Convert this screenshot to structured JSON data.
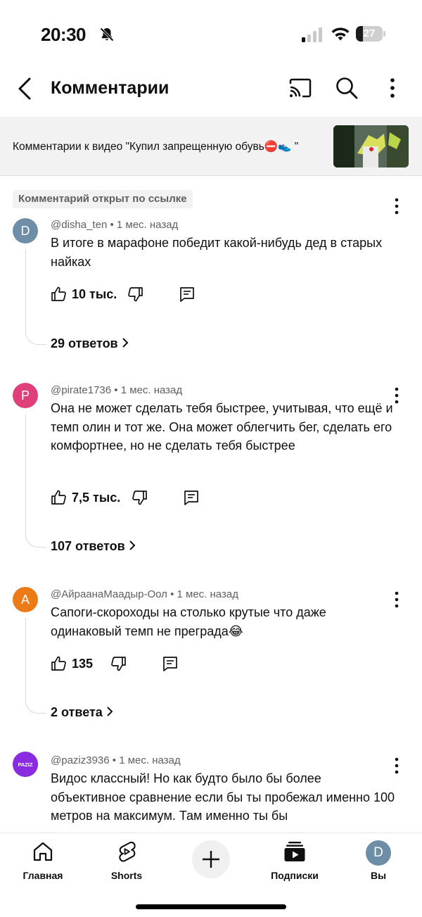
{
  "status_bar": {
    "time": "20:30",
    "battery": "27",
    "battery_level_percent": 27,
    "icons": [
      "bell-off-icon",
      "signal-icon",
      "wifi-icon",
      "battery-icon"
    ]
  },
  "header": {
    "title": "Комментарии",
    "icons": [
      "back-arrow-icon",
      "cast-icon",
      "search-icon",
      "more-vertical-icon"
    ]
  },
  "video_banner": {
    "text": "Комментарии к видео \"Купил запрещенную обувь⛔👟 \""
  },
  "link_badge": "Комментарий открыт по ссылке",
  "comments": [
    {
      "avatar_letter": "D",
      "avatar_color": "#6e8da6",
      "author": "@disha_ten",
      "time": "1 мес. назад",
      "text": "В итоге в марафоне победит какой-нибудь дед в старых найках",
      "likes": "10 тыс.",
      "replies": "29 ответов"
    },
    {
      "avatar_letter": "P",
      "avatar_color": "#e0407a",
      "author": "@pirate1736",
      "time": "1 мес. назад",
      "text": "Она не может сделать тебя быстрее, учитывая, что ещё и темп олин и тот же. Она может облегчить бег, сделать его комфортнее, но не сделать тебя быстрее",
      "likes": "7,5 тыс.",
      "replies": "107 ответов"
    },
    {
      "avatar_letter": "А",
      "avatar_color": "#ec7a16",
      "author": "@АйраанаМаадыр-Оол",
      "time": "1 мес. назад",
      "text": "Сапоги-скороходы на столько крутые что даже одинаковый темп не преграда😂",
      "likes": "135",
      "replies": "2 ответа"
    },
    {
      "avatar_letter": "PAZIZ",
      "avatar_color": "#8a2be2",
      "author": "@paziz3936",
      "time": "1 мес. назад",
      "text": "Видос классный! Но как будто было бы более объективное сравнение если бы ты пробежал именно 100 метров на максимум. Там именно ты бы"
    }
  ],
  "bottom_nav": {
    "items": [
      {
        "label": "Главная",
        "icon": "home-icon"
      },
      {
        "label": "Shorts",
        "icon": "shorts-icon"
      },
      {
        "label": "",
        "icon": "create-plus-icon"
      },
      {
        "label": "Подписки",
        "icon": "subscriptions-icon"
      },
      {
        "label": "Вы",
        "icon": "avatar",
        "avatar_letter": "D"
      }
    ]
  }
}
